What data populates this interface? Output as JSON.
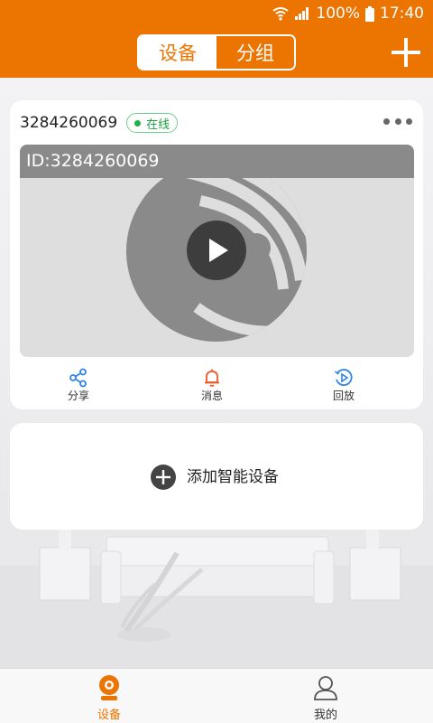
{
  "status_bar": {
    "battery": "100%",
    "time": "17:40",
    "icons": [
      "wifi-icon",
      "signal-icon",
      "battery-icon"
    ]
  },
  "header": {
    "tabs": [
      {
        "label": "设备",
        "active": true
      },
      {
        "label": "分组",
        "active": false
      }
    ],
    "add_icon": "plus-icon",
    "accent_color": "#ec7400"
  },
  "device_card": {
    "device_id": "3284260069",
    "status": "在线",
    "status_color": "#20b24a",
    "more_icon": "more-dots-icon",
    "preview": {
      "id_label": "ID:3284260069",
      "play_icon": "play-icon"
    },
    "actions": [
      {
        "label": "分享",
        "icon": "share-icon",
        "color": "#2f86e6"
      },
      {
        "label": "消息",
        "icon": "bell-icon",
        "color": "#ec5a2a"
      },
      {
        "label": "回放",
        "icon": "playback-icon",
        "color": "#2f86e6"
      }
    ]
  },
  "add_device": {
    "label": "添加智能设备",
    "icon": "plus-circle-icon"
  },
  "bottom_nav": [
    {
      "label": "设备",
      "icon": "camera-icon",
      "active": true
    },
    {
      "label": "我的",
      "icon": "user-icon",
      "active": false
    }
  ]
}
